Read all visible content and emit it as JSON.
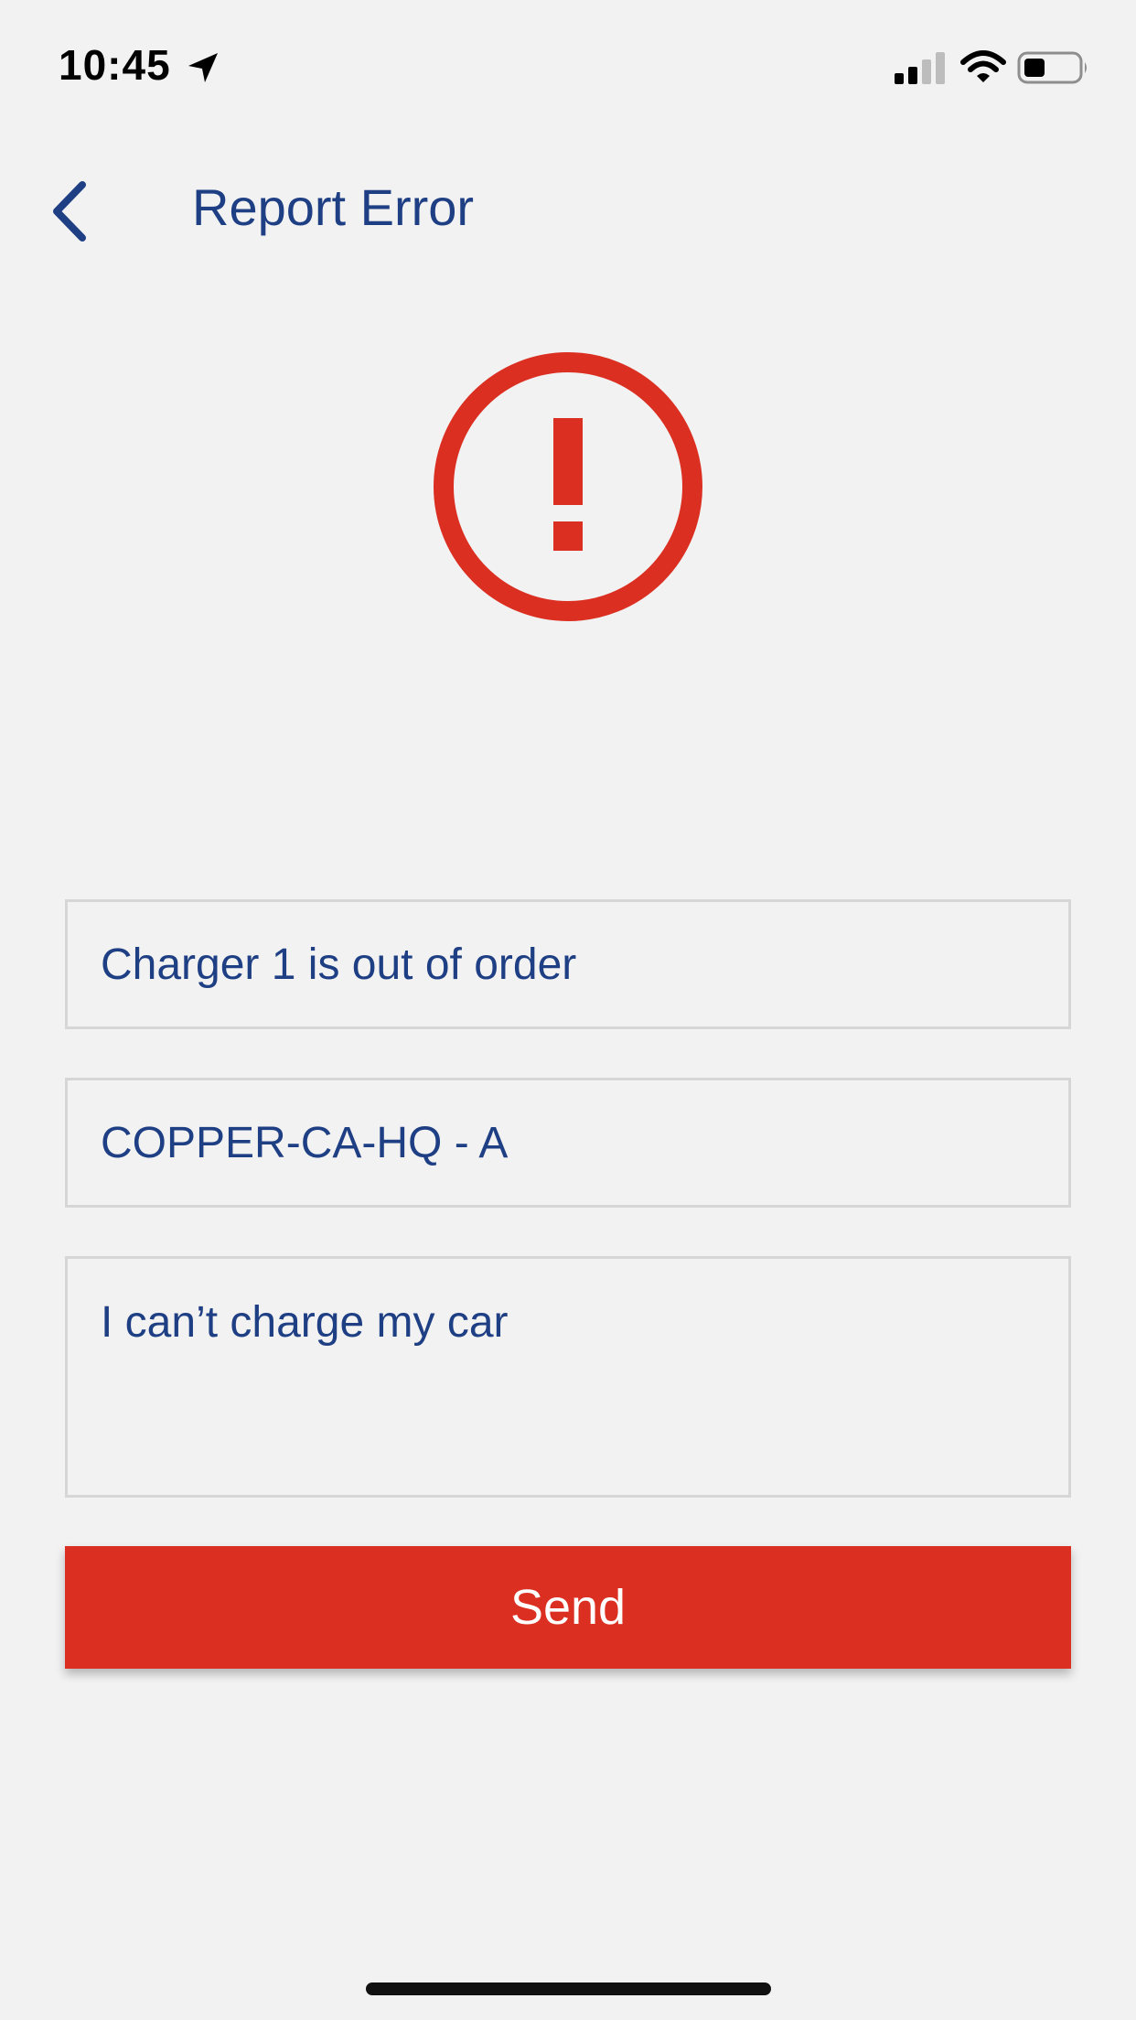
{
  "status_bar": {
    "time": "10:45",
    "location_icon": "location-arrow-icon",
    "signal_icon": "cellular-signal-icon",
    "wifi_icon": "wifi-icon",
    "battery_icon": "battery-icon"
  },
  "nav": {
    "back_icon": "chevron-left-icon",
    "title": "Report Error"
  },
  "alert": {
    "icon": "exclamation-circle-icon",
    "color": "#db2f22"
  },
  "form": {
    "title_value": "Charger 1 is out of order",
    "station_value": "COPPER-CA-HQ - A",
    "description_value": "I can’t charge my car",
    "send_label": "Send"
  },
  "colors": {
    "accent": "#db2f22",
    "text": "#1f3f84",
    "background": "#f2f2f2"
  }
}
